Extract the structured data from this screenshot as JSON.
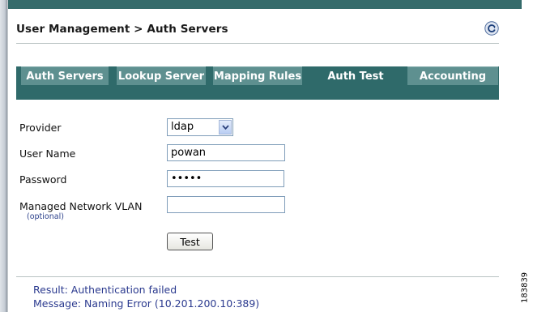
{
  "breadcrumb": "User Management > Auth Servers",
  "icons": {
    "refresh": "refresh-icon",
    "select_arrow": "chevron-down-icon"
  },
  "colors": {
    "accent": "#2f6a6a",
    "tab_inactive": "#5e9090",
    "result_text": "#2b3a8f"
  },
  "tabs": [
    {
      "label": "Auth Servers",
      "active": false
    },
    {
      "label": "Lookup Server",
      "active": false
    },
    {
      "label": "Mapping Rules",
      "active": false
    },
    {
      "label": "Auth Test",
      "active": true
    },
    {
      "label": "Accounting",
      "active": false
    }
  ],
  "form": {
    "provider": {
      "label": "Provider",
      "value": "ldap"
    },
    "username": {
      "label": "User Name",
      "value": "powan"
    },
    "password": {
      "label": "Password",
      "value": "•••••"
    },
    "vlan": {
      "label": "Managed Network VLAN",
      "note": "(optional)",
      "value": ""
    },
    "test_button": "Test"
  },
  "result": {
    "result_line": "Result: Authentication failed",
    "message_line": "Message: Naming Error (10.201.200.10:389)"
  },
  "figure_id": "183839"
}
